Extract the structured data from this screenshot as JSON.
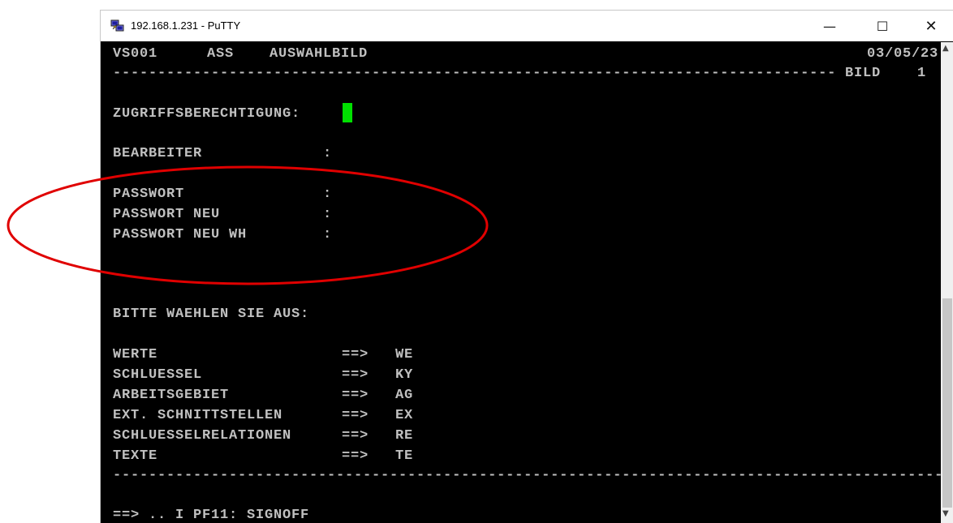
{
  "window": {
    "title": "192.168.1.231 - PuTTY",
    "minimize_glyph": "—",
    "maximize_glyph": "☐",
    "close_glyph": "✕",
    "icon": "putty-icon"
  },
  "terminal": {
    "header": {
      "program": "VS001",
      "system": "ASS",
      "screen_name": "AUSWAHLBILD",
      "date": "03/05/23",
      "separator": "------------------------------------------------------------------------------------",
      "page_label": "BILD",
      "page_number": "1"
    },
    "access_label": "ZUGRIFFSBERECHTIGUNG:",
    "fields": {
      "bearbeiter": "BEARBEITER",
      "passwort": "PASSWORT",
      "passwort_neu": "PASSWORT NEU",
      "passwort_neu_wh": "PASSWORT NEU WH",
      "colon": ":"
    },
    "prompt": "BITTE WAEHLEN SIE AUS:",
    "arrow": "==>",
    "menu": [
      {
        "label": "WERTE",
        "code": "WE"
      },
      {
        "label": "SCHLUESSEL",
        "code": "KY"
      },
      {
        "label": "ARBEITSGEBIET",
        "code": "AG"
      },
      {
        "label": "EXT. SCHNITTSTELLEN",
        "code": "EX"
      },
      {
        "label": "SCHLUESSELRELATIONEN",
        "code": "RE"
      },
      {
        "label": "TEXTE",
        "code": "TE"
      }
    ],
    "footer_separator": "---------------------------------------------------------------------------------------------",
    "command_line": "==> .. I PF11: SIGNOFF"
  },
  "colors": {
    "terminal_bg": "#000000",
    "terminal_text": "#c0c0c0",
    "cursor": "#00e000",
    "annotation": "#e00000"
  }
}
